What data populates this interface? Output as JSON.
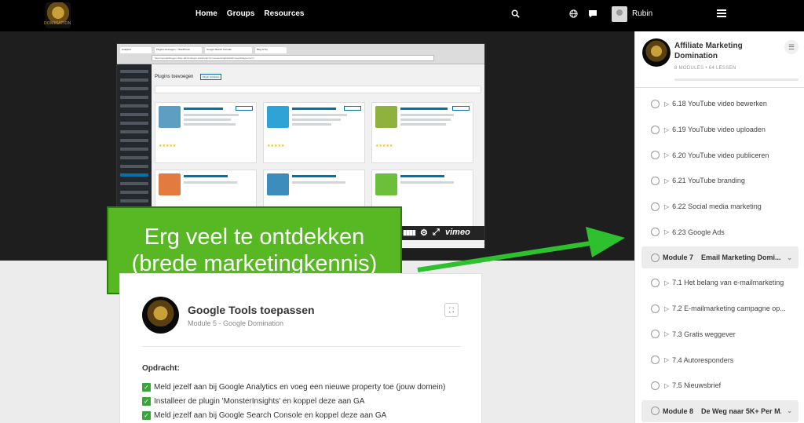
{
  "topbar": {
    "logo_text": "DOMINATION",
    "nav": [
      "Home",
      "Groups",
      "Resources"
    ],
    "user_name": "Rubin"
  },
  "video": {
    "browser_tabs": [
      "Analytics",
      "Plugins toevoegen < WordPress",
      "Google Search Console",
      "Blog & Tip"
    ],
    "url": "https://googleblogger.nl/wp-admin/plugin-install.php?s=monsterinsights&tab=search&type=term",
    "wp_title": "Plugins toevoegen",
    "wp_upload_btn": "Plugin uploaden",
    "vimeo_label": "vimeo"
  },
  "overlay": {
    "line1": "Erg veel te ontdekken",
    "line2": "(brede marketingkennis)"
  },
  "lesson": {
    "title": "Google Tools toepassen",
    "subtitle": "Module 5 - Google Domination",
    "opdracht": "Opdracht:",
    "tasks": [
      "Meld jezelf aan bij Google Analytics en voeg een nieuwe property toe (jouw domein)",
      "Installeer de plugin 'MonsterInsights' en koppel deze aan GA",
      "Meld jezelf aan bij Google Search Console en koppel deze aan GA"
    ]
  },
  "course": {
    "title": "Affiliate Marketing Domination",
    "modules_count": "8 MODULES",
    "lessons_count": "64 LESSEN",
    "progress": 0,
    "items": [
      {
        "type": "lesson",
        "label": "6.18 YouTube video bewerken"
      },
      {
        "type": "lesson",
        "label": "6.19 YouTube video uploaden"
      },
      {
        "type": "lesson",
        "label": "6.20 YouTube video publiceren"
      },
      {
        "type": "lesson",
        "label": "6.21 YouTube branding"
      },
      {
        "type": "lesson",
        "label": "6.22 Social media marketing"
      },
      {
        "type": "lesson",
        "label": "6.23 Google Ads"
      },
      {
        "type": "module",
        "num": "Module 7",
        "label": "Email Marketing Domi..."
      },
      {
        "type": "lesson",
        "label": "7.1 Het belang van e-mailmarketing"
      },
      {
        "type": "lesson",
        "label": "7.2 E-mailmarketing campagne op..."
      },
      {
        "type": "lesson",
        "label": "7.3 Gratis weggever"
      },
      {
        "type": "lesson",
        "label": "7.4 Autoresponders"
      },
      {
        "type": "lesson",
        "label": "7.5 Nieuwsbrief"
      },
      {
        "type": "module",
        "num": "Module 8",
        "label": "De Weg naar 5K+ Per M..."
      }
    ]
  },
  "colors": {
    "overlay_green": "#57b824",
    "arrow_green": "#2fc02f",
    "check_green": "#3aa63a"
  }
}
